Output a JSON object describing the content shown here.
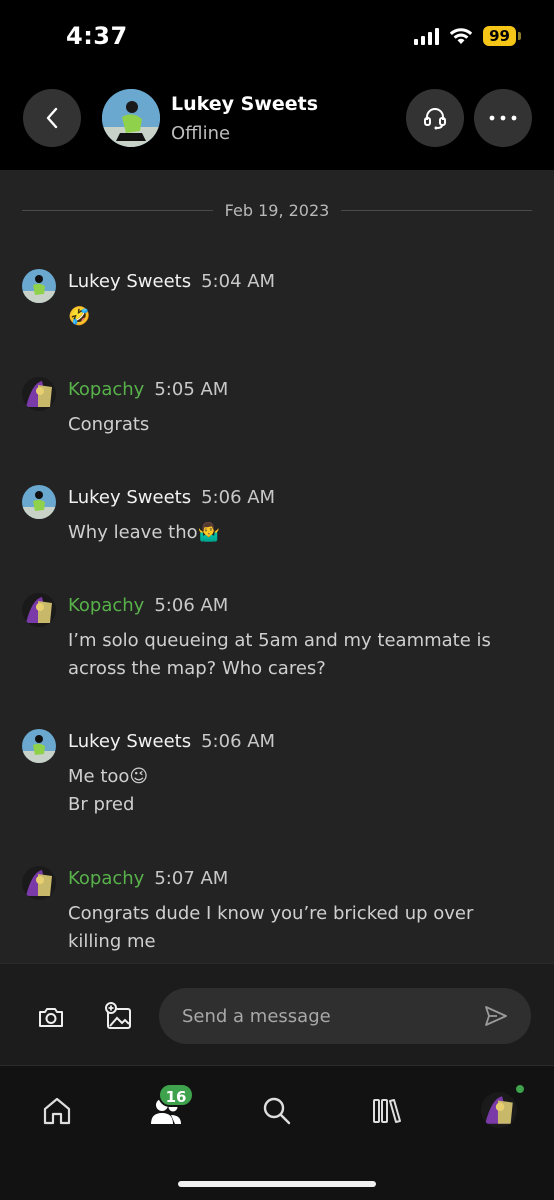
{
  "status_bar": {
    "time": "4:37",
    "battery": "99"
  },
  "header": {
    "contact_name": "Lukey Sweets",
    "contact_status": "Offline"
  },
  "chat": {
    "date_divider": "Feb 19, 2023",
    "messages": [
      {
        "sender": "Lukey Sweets",
        "time": "5:04 AM",
        "text": "🤣"
      },
      {
        "sender": "Kopachy",
        "time": "5:05 AM",
        "text": "Congrats"
      },
      {
        "sender": "Lukey Sweets",
        "time": "5:06 AM",
        "text": "Why leave tho🤷‍♂️"
      },
      {
        "sender": "Kopachy",
        "time": "5:06 AM",
        "text": "I’m solo queueing at 5am and my teammate is across the map? Who cares?"
      },
      {
        "sender": "Lukey Sweets",
        "time": "5:06 AM",
        "text": "Me too😉",
        "text2": "Br pred"
      },
      {
        "sender": "Kopachy",
        "time": "5:07 AM",
        "text": "Congrats dude I know you’re bricked up over killing me"
      }
    ]
  },
  "composer": {
    "placeholder": "Send a message"
  },
  "nav": {
    "social_badge": "16"
  },
  "colors": {
    "kopachy_name": "#58b24a",
    "badge_green": "#3fa34d",
    "battery_yellow": "#f5c518"
  },
  "icons": [
    "chevron-left-icon",
    "headset-icon",
    "more-icon",
    "camera-icon",
    "image-add-icon",
    "send-icon",
    "home-icon",
    "social-icon",
    "search-icon",
    "library-icon"
  ]
}
